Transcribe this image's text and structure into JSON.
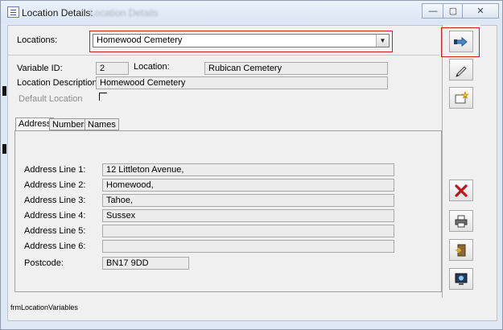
{
  "window": {
    "title": "Location Details:",
    "title_obscured": "Location Details",
    "min_label": "—",
    "max_label": "▢",
    "close_label": "✕"
  },
  "header": {
    "locations_label": "Locations:",
    "locations_value": "Homewood Cemetery",
    "dropdown_arrow": "▼"
  },
  "details": {
    "variable_id_label": "Variable ID:",
    "variable_id_value": "2",
    "location_label": "Location:",
    "location_value": "Rubican Cemetery",
    "description_label": "Location Description:",
    "description_value": "Homewood Cemetery",
    "default_label": "Default Location",
    "default_checked": false
  },
  "tabs": [
    {
      "label": "Address"
    },
    {
      "label": "Numbers"
    },
    {
      "label": "Names"
    }
  ],
  "address": [
    {
      "label": "Address Line 1:",
      "value": "12 Littleton Avenue,"
    },
    {
      "label": "Address Line 2:",
      "value": "Homewood,"
    },
    {
      "label": "Address Line 3:",
      "value": "Tahoe,"
    },
    {
      "label": "Address Line 4:",
      "value": "Sussex"
    },
    {
      "label": "Address Line 5:",
      "value": ""
    },
    {
      "label": "Address Line 6:",
      "value": ""
    }
  ],
  "postcode": {
    "label": "Postcode:",
    "value": "BN17 9DD"
  },
  "footer": {
    "form_name": "frmLocationVariables"
  },
  "toolbar": {
    "icons": [
      "go-to-record-icon",
      "edit-record-icon",
      "new-record-icon",
      "delete-icon",
      "print-icon",
      "exit-icon",
      "preview-icon"
    ],
    "delete_color": "#c0161b",
    "highlight_color": "#cc2020"
  }
}
